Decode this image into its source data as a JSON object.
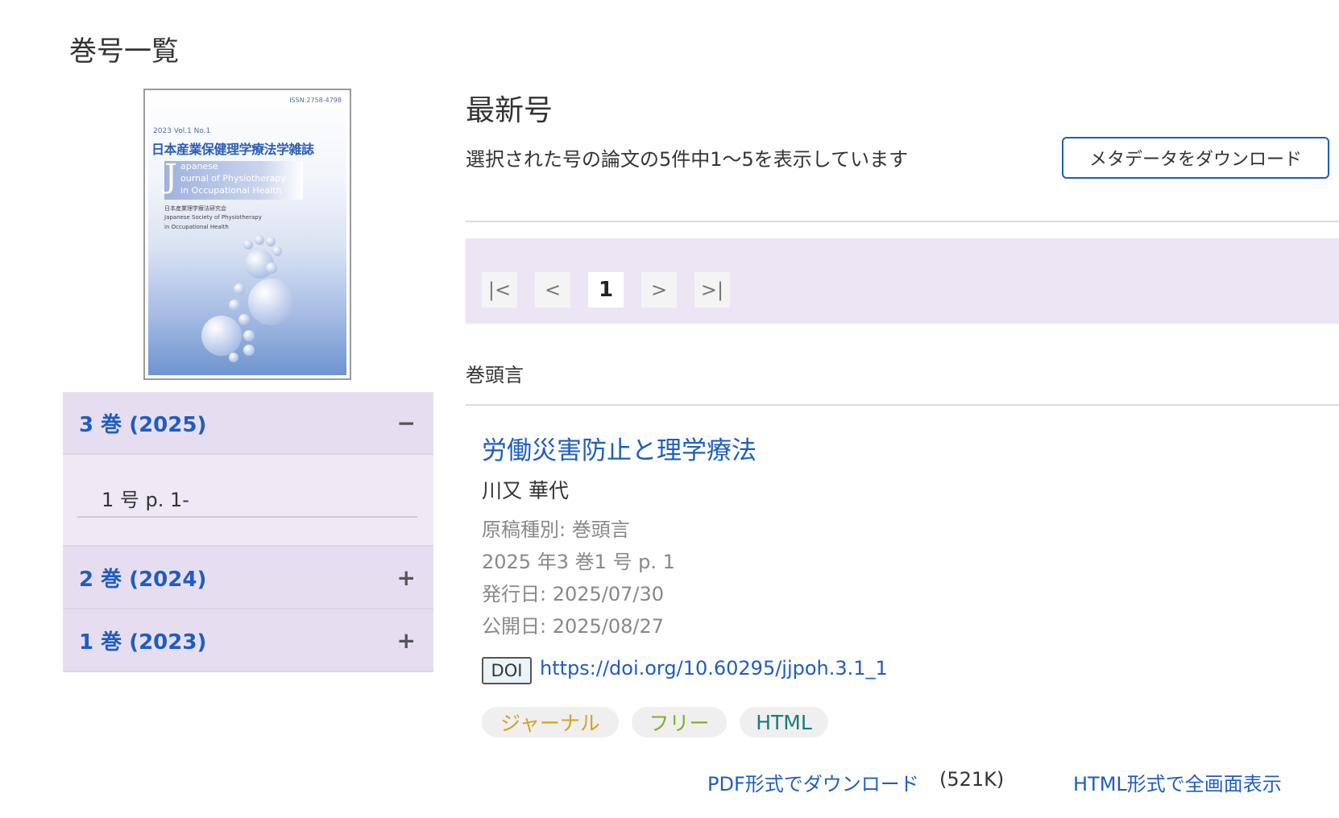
{
  "page": {
    "title": "巻号一覧"
  },
  "cover": {
    "issn": "ISSN:2758-4798",
    "vol_line": "2023 Vol.1 No.1",
    "title_ja": "日本産業保健理学療法学雑誌",
    "title_en_initial": "J",
    "title_en_line1": "apanese",
    "title_en_line2": "ournal of Physiotherapy",
    "title_en_line3": "in Occupational Health",
    "society_ja": "日本産業理学療法研究会",
    "society_en_line1": "Japanese Society of Physiotherapy",
    "society_en_line2": "in Occupational Health"
  },
  "volumes": [
    {
      "label": "3 巻 (2025)",
      "toggle": "−",
      "expanded": true,
      "issues": [
        {
          "label": "1 号 p. 1-"
        }
      ]
    },
    {
      "label": "2 巻 (2024)",
      "toggle": "+",
      "expanded": false
    },
    {
      "label": "1 巻 (2023)",
      "toggle": "+",
      "expanded": false
    }
  ],
  "main": {
    "section_title": "最新号",
    "result_count": "選択された号の論文の5件中1〜5を表示しています",
    "metadata_button": "メタデータをダウンロード"
  },
  "pagination": {
    "first": "|<",
    "prev": "<",
    "current": "1",
    "next": ">",
    "last": ">|"
  },
  "category": "巻頭言",
  "article": {
    "title": "労働災害防止と理学療法",
    "author": "川又 華代",
    "manuscript_type": "原稿種別: 巻頭言",
    "citation": "2025 年3 巻1 号 p. 1",
    "published": "発行日: 2025/07/30",
    "released": "公開日: 2025/08/27",
    "doi_label": "DOI",
    "doi_url": "https://doi.org/10.60295/jjpoh.3.1_1",
    "tags": [
      "ジャーナル",
      "フリー",
      "HTML"
    ],
    "pdf_link": "PDF形式でダウンロード",
    "pdf_size": "(521K)",
    "html_link": "HTML形式で全画面表示"
  },
  "colors": {
    "link": "#1f5dbd",
    "volume_header_bg": "#e6def0",
    "pager_bg": "#ece6f4",
    "tag_journal": "#d1a31e",
    "tag_free": "#7db122",
    "tag_html": "#1d7a7a"
  }
}
